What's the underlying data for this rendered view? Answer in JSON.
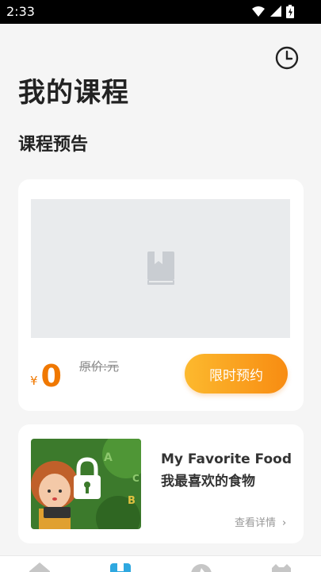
{
  "status_bar": {
    "time": "2:33"
  },
  "header": {
    "title": "我的课程",
    "history_icon": "clock-icon"
  },
  "preview_section": {
    "title": "课程预告",
    "image_placeholder_icon": "book-icon",
    "price_currency": "¥",
    "price_value": "0",
    "original_price": "原价:元",
    "reserve_button": "限时预约"
  },
  "course": {
    "title": "My Favorite Food 我最喜欢的食物",
    "detail_link": "查看详情",
    "thumbnail_icon": "lock-icon"
  },
  "bottom_nav": {
    "items": [
      "home-icon",
      "course-icon",
      "discover-icon",
      "profile-icon"
    ],
    "active_index": 1
  },
  "colors": {
    "accent": "#f88c12",
    "accent_light": "#fcb92e",
    "active_nav": "#2fa8e0",
    "thumbnail_green": "#3c7a2c"
  }
}
